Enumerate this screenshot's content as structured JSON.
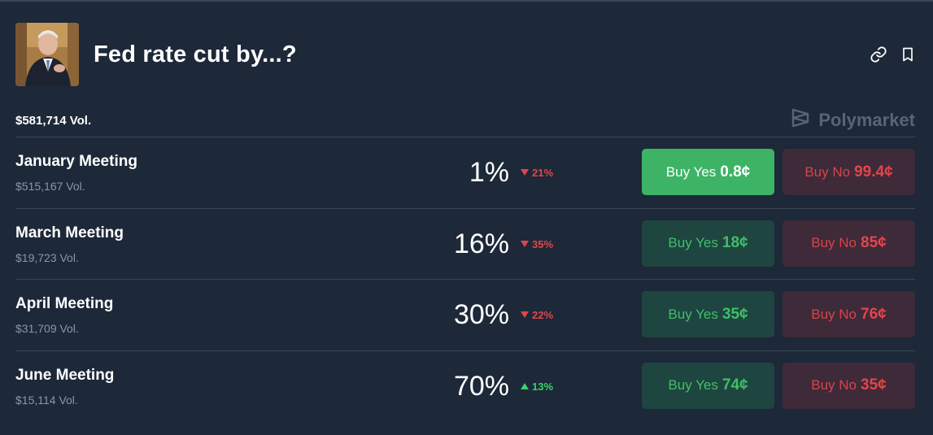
{
  "market": {
    "title": "Fed rate cut by...?",
    "total_volume": "$581,714 Vol.",
    "brand": "Polymarket"
  },
  "outcomes": [
    {
      "name": "January Meeting",
      "volume": "$515,167 Vol.",
      "probability": "1%",
      "change": "21%",
      "change_direction": "down",
      "yes_label": "Buy Yes",
      "yes_price": "0.8¢",
      "no_label": "Buy No",
      "no_price": "99.4¢",
      "yes_active": true
    },
    {
      "name": "March Meeting",
      "volume": "$19,723 Vol.",
      "probability": "16%",
      "change": "35%",
      "change_direction": "down",
      "yes_label": "Buy Yes",
      "yes_price": "18¢",
      "no_label": "Buy No",
      "no_price": "85¢",
      "yes_active": false
    },
    {
      "name": "April Meeting",
      "volume": "$31,709 Vol.",
      "probability": "30%",
      "change": "22%",
      "change_direction": "down",
      "yes_label": "Buy Yes",
      "yes_price": "35¢",
      "no_label": "Buy No",
      "no_price": "76¢",
      "yes_active": false
    },
    {
      "name": "June Meeting",
      "volume": "$15,114 Vol.",
      "probability": "70%",
      "change": "13%",
      "change_direction": "up",
      "yes_label": "Buy Yes",
      "yes_price": "74¢",
      "no_label": "Buy No",
      "no_price": "35¢",
      "yes_active": false
    }
  ],
  "colors": {
    "background": "#1d2838",
    "yes_green": "#3db366",
    "no_red": "#e4454c"
  },
  "icons": [
    "link-icon",
    "bookmark-icon",
    "polymarket-logo-icon",
    "triangle-down-icon",
    "triangle-up-icon"
  ]
}
